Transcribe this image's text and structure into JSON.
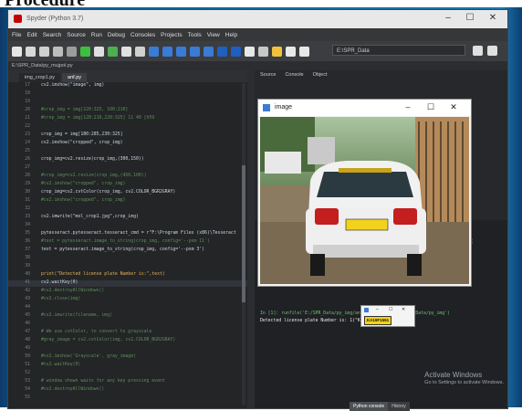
{
  "caption": "Procedure",
  "window": {
    "title": "Spyder (Python 3.7)",
    "controls": [
      "–",
      "☐",
      "✕"
    ]
  },
  "menu": [
    "File",
    "Edit",
    "Search",
    "Source",
    "Run",
    "Debug",
    "Consoles",
    "Projects",
    "Tools",
    "View",
    "Help"
  ],
  "toolbar": {
    "path": "E:\\SPR_Data"
  },
  "subpath": "E:\\SPR_Data\\py_mujpol.py",
  "editor": {
    "tabs": [
      "img_crop1.py",
      "anf.py"
    ],
    "lines": [
      {
        "n": "17",
        "t": "cv2.imshow(\"image\", img)",
        "k": "cd"
      },
      {
        "n": "18",
        "t": "",
        "k": "cd"
      },
      {
        "n": "19",
        "t": "",
        "k": "cd"
      },
      {
        "n": "20",
        "t": "#crop_img = img[220:325, 100:210]",
        "k": "cm"
      },
      {
        "n": "21",
        "t": "#crop_img = img[128:210,220:325] 11 40 [h59",
        "k": "cm"
      },
      {
        "n": "22",
        "t": "",
        "k": "cd"
      },
      {
        "n": "23",
        "t": "crop_img = img[180:285,230:325]",
        "k": "cd"
      },
      {
        "n": "24",
        "t": "cv2.imshow(\"cropped\", crop_img)",
        "k": "cd"
      },
      {
        "n": "25",
        "t": "",
        "k": "cd"
      },
      {
        "n": "26",
        "t": "crop_img=cv2.resize(crop_img,(300,150))",
        "k": "cd"
      },
      {
        "n": "27",
        "t": "",
        "k": "cd"
      },
      {
        "n": "28",
        "t": "#crop_img=cv2.resize(crop_img,(450,100))",
        "k": "cm"
      },
      {
        "n": "29",
        "t": "#cv2.imshow(\"cropped\", crop_img)",
        "k": "cm"
      },
      {
        "n": "30",
        "t": "crop_img=cv2.cvtColor(crop_img, cv2.COLOR_BGR2GRAY)",
        "k": "cd"
      },
      {
        "n": "31",
        "t": "#cv2.imshow(\"cropped\", crop_img)",
        "k": "cm"
      },
      {
        "n": "32",
        "t": "",
        "k": "cd"
      },
      {
        "n": "33",
        "t": "cv2.imwrite(\"mol_crop1.jpg\",crop_img)",
        "k": "cd"
      },
      {
        "n": "34",
        "t": "",
        "k": "cd"
      },
      {
        "n": "35",
        "t": "pytesseract.pytesseract.tesseract_cmd = r\"F:\\Program Files (x86)\\Tesseract",
        "k": "cd"
      },
      {
        "n": "36",
        "t": "#text = pytesseract.image_to_string(crop_img, config='--psm 11')",
        "k": "cm"
      },
      {
        "n": "37",
        "t": "text = pytesseract.image_to_string(crop_img, config='--psm 3')",
        "k": "cd"
      },
      {
        "n": "38",
        "t": "",
        "k": "cd"
      },
      {
        "n": "39",
        "t": "",
        "k": "cd"
      },
      {
        "n": "40",
        "t": "print(\"Detected license plate Number is:\",text)",
        "k": "pr"
      },
      {
        "n": "41",
        "t": "cv2.waitKey(0)",
        "k": "cd"
      },
      {
        "n": "42",
        "t": "#cv2.destroyAllWindows()",
        "k": "cm"
      },
      {
        "n": "43",
        "t": "#cv2.close(img)",
        "k": "cm"
      },
      {
        "n": "44",
        "t": "",
        "k": "cd"
      },
      {
        "n": "45",
        "t": "#cv2.imwrite(filename, img)",
        "k": "cm"
      },
      {
        "n": "46",
        "t": "",
        "k": "cd"
      },
      {
        "n": "47",
        "t": "# We use cvtColor, to convert to grayscale",
        "k": "cm"
      },
      {
        "n": "48",
        "t": "#gray_image = cv2.cvtColor(img, cv2.COLOR_BGR2GRAY)",
        "k": "cm"
      },
      {
        "n": "49",
        "t": "",
        "k": "cd"
      },
      {
        "n": "50",
        "t": "#cv2.imshow('Grayscale', gray_image)",
        "k": "cm"
      },
      {
        "n": "51",
        "t": "#cv2.waitKey(0)",
        "k": "cm"
      },
      {
        "n": "52",
        "t": "",
        "k": "cd"
      },
      {
        "n": "53",
        "t": "# window shown waits for any key pressing event",
        "k": "cm"
      },
      {
        "n": "54",
        "t": "#cv2.destroyAllWindows()",
        "k": "cm"
      },
      {
        "n": "55",
        "t": "",
        "k": "cd"
      }
    ]
  },
  "right_pane": {
    "tabs": [
      "Source",
      "Console",
      "Object"
    ]
  },
  "console": {
    "line1": "In [1]: runfile('E:/SPR_Data/py_img/anf1.py', wdir='E:/SPR_Data/py_img')",
    "line2": "Detected license plate Number is: 1(\"KA19F1551\")",
    "tabs": [
      "Python console",
      "History"
    ]
  },
  "image_window": {
    "title": "image",
    "controls": [
      "–",
      "☐",
      "✕"
    ]
  },
  "plate_window": {
    "controls": [
      "–",
      "☐",
      "✕"
    ],
    "plate_text": "KA19F1551"
  },
  "watermark": {
    "title": "Activate Windows",
    "sub": "Go to Settings to activate Windows."
  },
  "colors": {
    "accent": "#1c76ad",
    "plate_yellow": "#f2d21a"
  }
}
